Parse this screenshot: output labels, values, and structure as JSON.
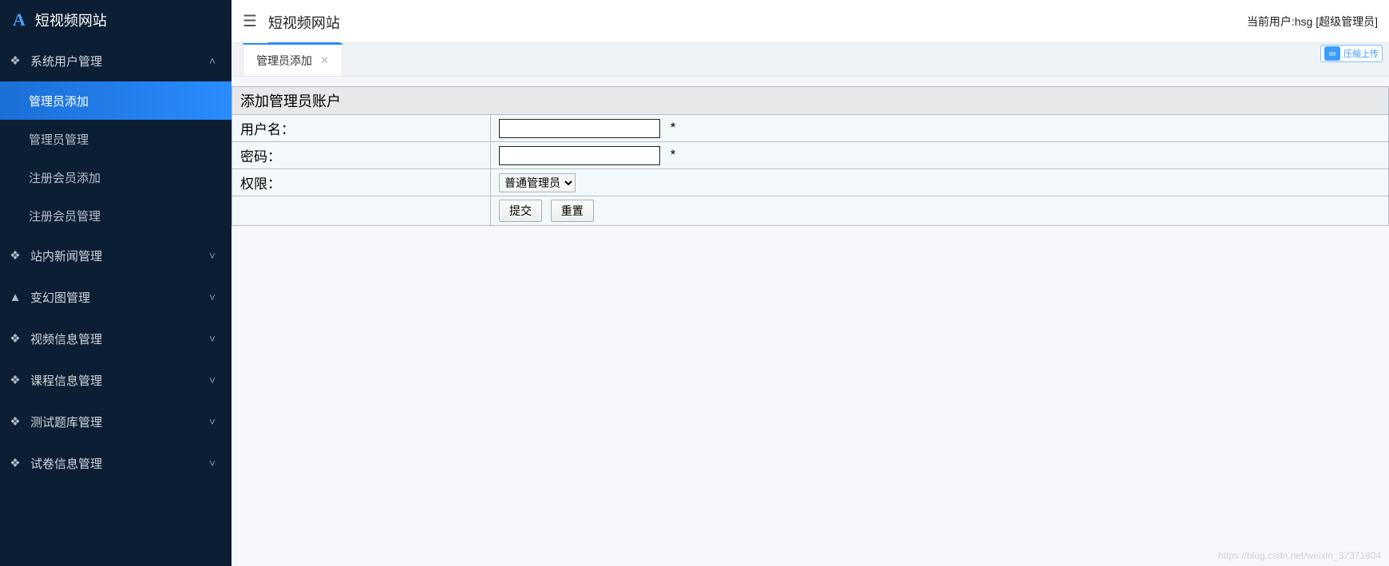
{
  "sidebar": {
    "title": "短视频网站",
    "groups": [
      {
        "icon": "cube",
        "label": "系统用户管理",
        "open": true,
        "items": [
          "管理员添加",
          "管理员管理",
          "注册会员添加",
          "注册会员管理"
        ],
        "active_item": 0
      },
      {
        "icon": "cube",
        "label": "站内新闻管理",
        "open": false
      },
      {
        "icon": "user",
        "label": "变幻图管理",
        "open": false
      },
      {
        "icon": "cube",
        "label": "视频信息管理",
        "open": false
      },
      {
        "icon": "cube",
        "label": "课程信息管理",
        "open": false
      },
      {
        "icon": "cube",
        "label": "测试题库管理",
        "open": false
      },
      {
        "icon": "cube",
        "label": "试卷信息管理",
        "open": false
      }
    ]
  },
  "topbar": {
    "breadcrumb": "短视频网站",
    "user_label": "当前用户:hsg [超级管理员]",
    "upload_text": "压缩上传"
  },
  "tabs": [
    {
      "label": "管理员添加",
      "closable": true,
      "active": true
    }
  ],
  "form": {
    "header": "添加管理员账户",
    "rows": {
      "username_label": "用户名：",
      "username_value": "",
      "username_required": "*",
      "password_label": "密码：",
      "password_value": "",
      "password_required": "*",
      "role_label": "权限：",
      "role_selected": "普通管理员"
    },
    "buttons": {
      "submit": "提交",
      "reset": "重置"
    }
  },
  "watermark": "https://blog.csdn.net/weixin_37371604"
}
